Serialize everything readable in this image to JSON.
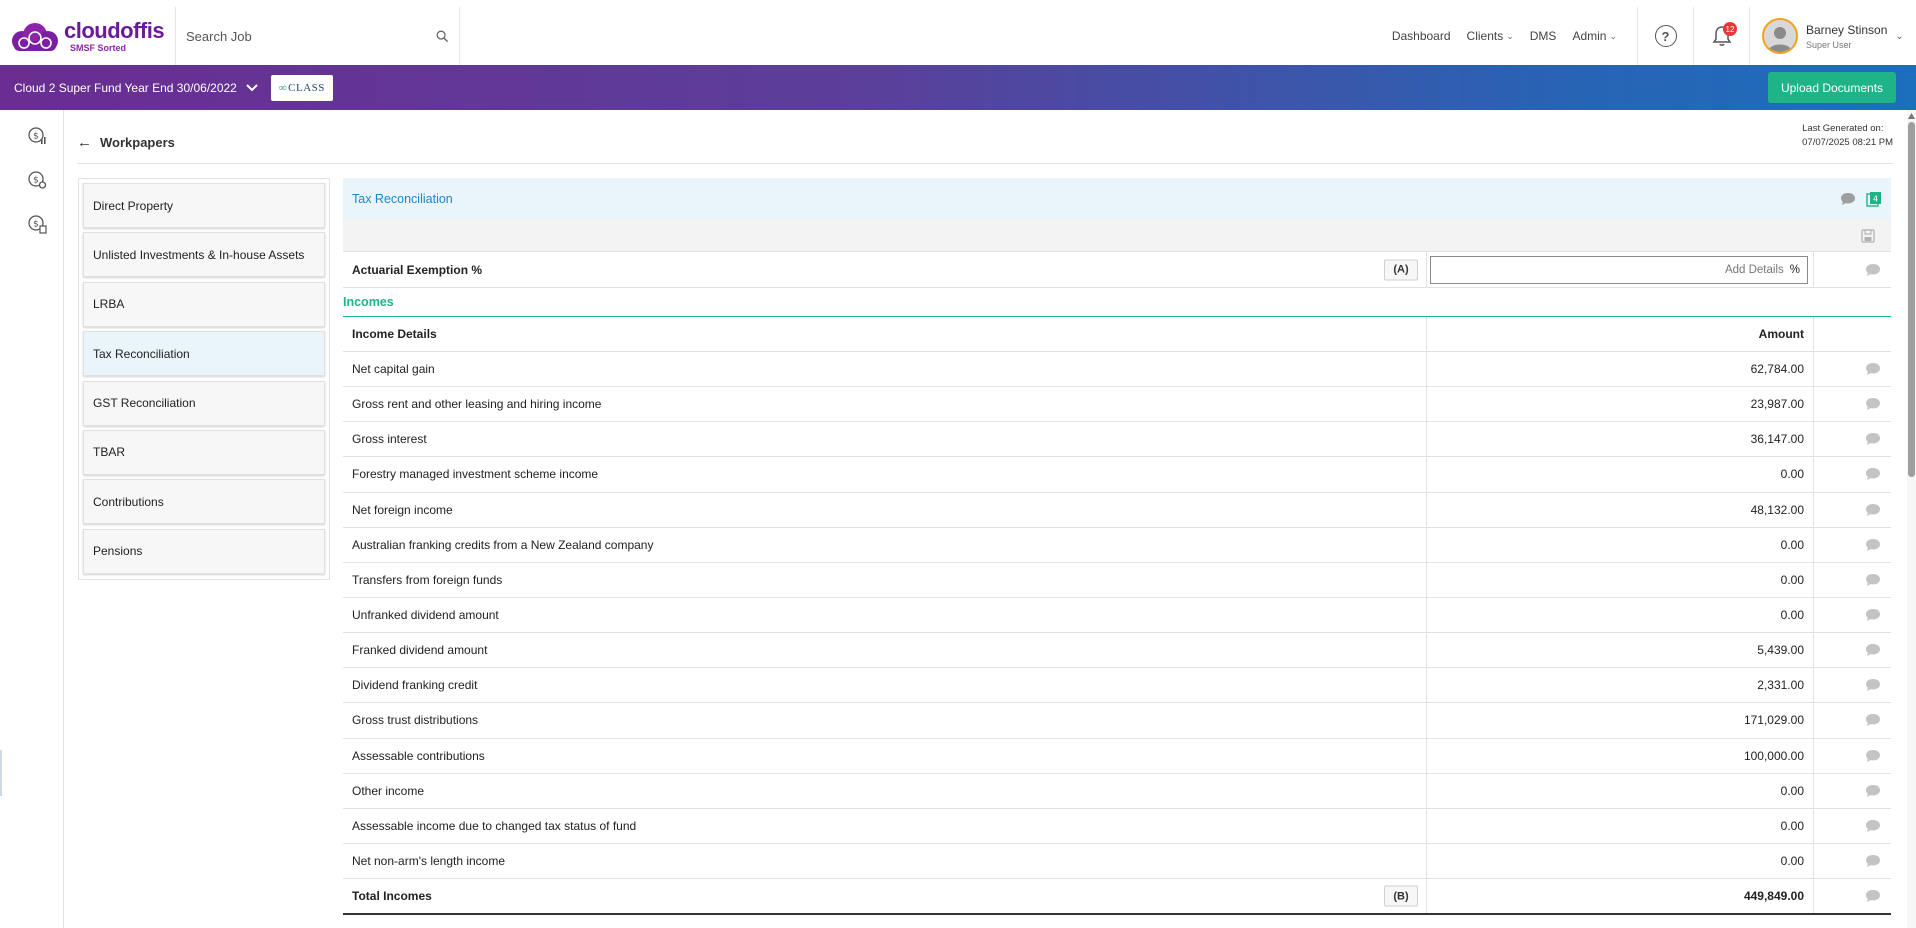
{
  "brand": {
    "name": "cloudoffis",
    "tagline": "SMSF Sorted"
  },
  "search": {
    "placeholder": "Search Job"
  },
  "nav": {
    "links": [
      {
        "label": "Dashboard",
        "caret": false
      },
      {
        "label": "Clients",
        "caret": true
      },
      {
        "label": "DMS",
        "caret": false
      },
      {
        "label": "Admin",
        "caret": true
      }
    ],
    "notification_count": "12"
  },
  "user": {
    "name": "Barney Stinson",
    "role": "Super User"
  },
  "banner": {
    "fund_title": "Cloud 2 Super Fund Year End 30/06/2022",
    "class_logo": "CLASS",
    "upload_label": "Upload Documents"
  },
  "workpapers": {
    "title": "Workpapers",
    "last_generated_label": "Last Generated on:",
    "last_generated_value": "07/07/2025 08:21 PM"
  },
  "menu": {
    "items": [
      {
        "label": "Direct Property",
        "active": false
      },
      {
        "label": "Unlisted Investments & In-house Assets",
        "active": false
      },
      {
        "label": "LRBA",
        "active": false
      },
      {
        "label": "Tax Reconciliation",
        "active": true
      },
      {
        "label": "GST Reconciliation",
        "active": false
      },
      {
        "label": "TBAR",
        "active": false
      },
      {
        "label": "Contributions",
        "active": false
      },
      {
        "label": "Pensions",
        "active": false
      }
    ]
  },
  "tax_reconciliation": {
    "title": "Tax Reconciliation",
    "doc_count": "4",
    "actuarial": {
      "label": "Actuarial Exemption %",
      "tag": "(A)",
      "placeholder": "Add Details",
      "unit": "%"
    },
    "incomes": {
      "section_title": "Incomes",
      "col_detail": "Income Details",
      "col_amount": "Amount",
      "rows": [
        {
          "label": "Net capital gain",
          "amount": "62,784.00"
        },
        {
          "label": "Gross rent and other leasing and hiring income",
          "amount": "23,987.00"
        },
        {
          "label": "Gross interest",
          "amount": "36,147.00"
        },
        {
          "label": "Forestry managed investment scheme income",
          "amount": "0.00"
        },
        {
          "label": "Net foreign income",
          "amount": "48,132.00"
        },
        {
          "label": "Australian franking credits from a New Zealand company",
          "amount": "0.00"
        },
        {
          "label": "Transfers from foreign funds",
          "amount": "0.00"
        },
        {
          "label": "Unfranked dividend amount",
          "amount": "0.00"
        },
        {
          "label": "Franked dividend amount",
          "amount": "5,439.00"
        },
        {
          "label": "Dividend franking credit",
          "amount": "2,331.00"
        },
        {
          "label": "Gross trust distributions",
          "amount": "171,029.00"
        },
        {
          "label": "Assessable contributions",
          "amount": "100,000.00"
        },
        {
          "label": "Other income",
          "amount": "0.00"
        },
        {
          "label": "Assessable income due to changed tax status of fund",
          "amount": "0.00"
        },
        {
          "label": "Net non-arm's length income",
          "amount": "0.00"
        }
      ],
      "total": {
        "label": "Total Incomes",
        "tag": "(B)",
        "amount": "449,849.00"
      }
    }
  },
  "colors": {
    "brand_purple": "#6a1b9a",
    "accent_green": "#1eb488",
    "link_blue": "#1e88c7",
    "header_tint": "#e9f4fb"
  },
  "icons": {
    "search": "search-icon",
    "help": "help-icon",
    "bell": "bell-icon",
    "back": "arrow-left-icon",
    "comment": "comment-icon",
    "documents": "document-stack-icon",
    "save": "save-icon",
    "rail": [
      "dollar-chart-icon",
      "dollar-settings-icon",
      "dollar-report-icon"
    ]
  }
}
